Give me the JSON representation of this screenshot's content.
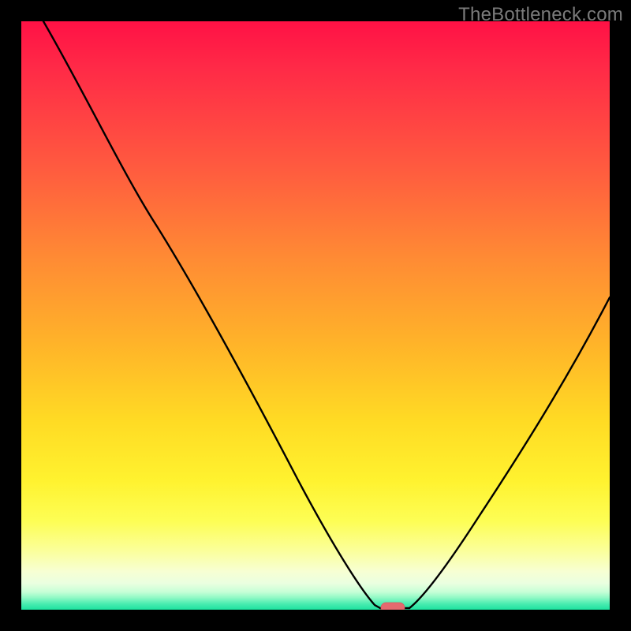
{
  "watermark": "TheBottleneck.com",
  "colors": {
    "frame": "#000000",
    "curve": "#000000",
    "marker_fill": "#e46a6f",
    "marker_stroke": "#d85a60",
    "gradient_top": "#ff1145",
    "gradient_mid": "#ffdb24",
    "gradient_bottom": "#1de29f"
  },
  "chart_data": {
    "type": "line",
    "title": "",
    "xlabel": "",
    "ylabel": "",
    "xlim": [
      0,
      100
    ],
    "ylim": [
      0,
      100
    ],
    "grid": false,
    "legend": false,
    "description": "Bottleneck curve: y is percentage bottleneck vs x. Minimum (optimal point) around x≈62 where y≈0. Steep descent on left branch, moderate ascent on right branch.",
    "x": [
      0,
      5,
      10,
      15,
      20,
      25,
      30,
      35,
      40,
      45,
      50,
      55,
      58,
      60,
      62,
      64,
      66,
      70,
      75,
      80,
      85,
      90,
      95,
      100
    ],
    "values": [
      100,
      95,
      89,
      82,
      73,
      64,
      55,
      47,
      38,
      29,
      20,
      11,
      5,
      1,
      0,
      0,
      2,
      8,
      15,
      23,
      31,
      39,
      47,
      55
    ],
    "optimal_point": {
      "x": 62,
      "y": 0
    }
  }
}
